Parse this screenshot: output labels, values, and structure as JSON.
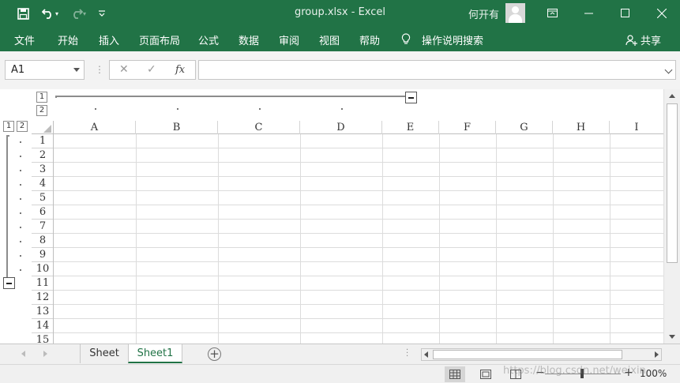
{
  "title_bar": {
    "title": "group.xlsx  -  Excel",
    "user_name": "何开有",
    "accent_color": "#217346"
  },
  "quick_access": {
    "icons": [
      "save-icon",
      "undo-icon",
      "redo-icon",
      "customize-icon"
    ]
  },
  "ribbon": {
    "tabs": [
      "文件",
      "开始",
      "插入",
      "页面布局",
      "公式",
      "数据",
      "审阅",
      "视图",
      "帮助"
    ],
    "tell_me": "操作说明搜索",
    "share": "共享"
  },
  "formula_bar": {
    "name_box": "A1",
    "formula": "",
    "fx_label": "fx"
  },
  "outline": {
    "col_levels": [
      "1",
      "2"
    ],
    "row_levels": [
      "1",
      "2"
    ]
  },
  "columns": [
    "A",
    "B",
    "C",
    "D",
    "E",
    "F",
    "G",
    "H",
    "I"
  ],
  "rows": [
    "1",
    "2",
    "3",
    "4",
    "5",
    "6",
    "7",
    "8",
    "9",
    "10",
    "11",
    "12",
    "13",
    "14",
    "15"
  ],
  "sheets": {
    "tabs": [
      {
        "name": "Sheet",
        "active": false
      },
      {
        "name": "Sheet1",
        "active": true
      }
    ]
  },
  "status_bar": {
    "zoom": "100%"
  },
  "watermark": "https://blog.csdn.net/weixin_"
}
